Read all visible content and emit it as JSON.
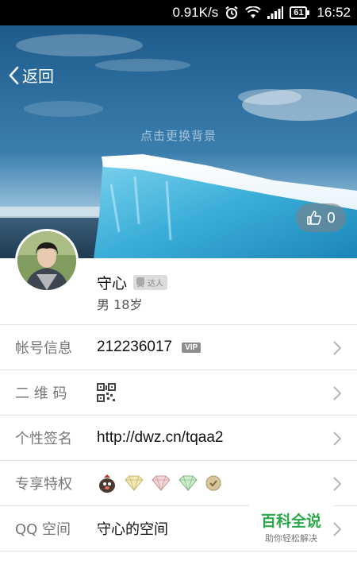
{
  "status_bar": {
    "speed": "0.91K/s",
    "battery": "61",
    "time": "16:52",
    "icons": [
      "alarm-icon",
      "wifi-icon",
      "signal-icon",
      "battery-icon"
    ]
  },
  "banner": {
    "back_label": "返回",
    "change_bg_hint": "点击更换背景",
    "like_count": "0"
  },
  "profile": {
    "name": "守心",
    "expert_badge": "达人",
    "gender_age": "男 18岁"
  },
  "rows": [
    {
      "label": "帐号信息",
      "value": "212236017",
      "badge": "VIP"
    },
    {
      "label": "二 维 码",
      "value_icon": "qr-code-icon"
    },
    {
      "label": "个性签名",
      "value": "http://dwz.cn/tqaa2"
    },
    {
      "label": "专享特权",
      "value_icons": [
        "mole-icon",
        "diamond-yellow-icon",
        "diamond-pink-icon",
        "diamond-green-icon",
        "medal-icon"
      ]
    },
    {
      "label": "QQ 空间",
      "value": "守心的空间"
    }
  ],
  "watermark": {
    "title": "百科全说",
    "subtitle": "助你轻松解决"
  },
  "colors": {
    "status_bar_bg": "#000000",
    "accent_green": "#2aa84a",
    "label_gray": "#777777"
  }
}
